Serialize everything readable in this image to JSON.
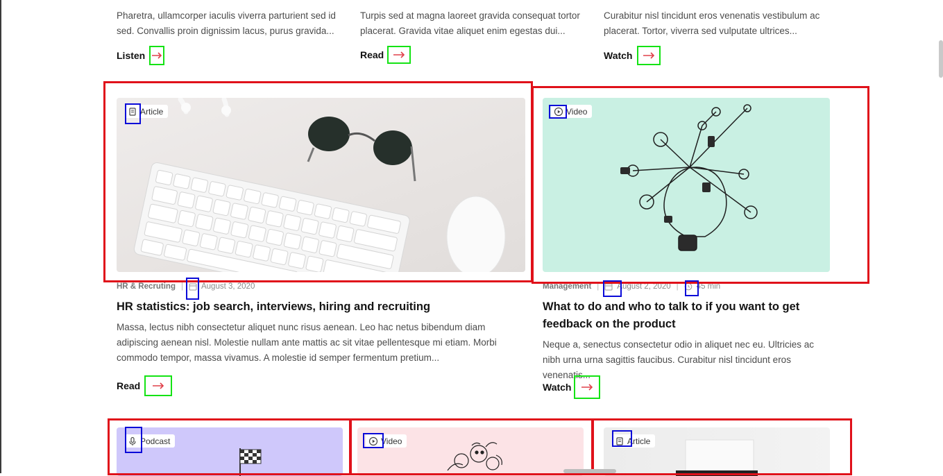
{
  "top_row": [
    {
      "excerpt": "Pharetra, ullamcorper iaculis viverra parturient sed id sed. Convallis proin dignissim lacus, purus gravida...",
      "cta": "Listen"
    },
    {
      "excerpt": "Turpis sed at magna laoreet gravida consequat tortor placerat. Gravida vitae aliquet enim egestas dui...",
      "cta": "Read"
    },
    {
      "excerpt": "Curabitur nisl tincidunt eros venenatis vestibulum ac placerat. Tortor, viverra sed vulputate ultrices...",
      "cta": "Watch"
    }
  ],
  "featured": [
    {
      "badge": "Article",
      "badge_icon": "document-icon",
      "category": "HR & Recruting",
      "date": "August 3, 2020",
      "title": "HR statistics: job search,  interviews, hiring and recruiting",
      "excerpt": "Massa, lectus nibh consectetur aliquet nunc risus aenean. Leo hac netus bibendum diam adipiscing aenean nisl. Molestie nullam ante mattis ac sit vitae pellentesque mi etiam. Morbi commodo tempor, massa vivamus. A molestie id semper fermentum pretium...",
      "cta": "Read"
    },
    {
      "badge": "Video",
      "badge_icon": "play-icon",
      "category": "Management",
      "date": "August 2, 2020",
      "duration": "45 min",
      "title": "What to do and who to talk to if you want to get feedback on the product",
      "excerpt": "Neque a, senectus consectetur odio in aliquet nec eu. Ultricies ac nibh urna urna sagittis faucibus. Curabitur nisl tincidunt eros venenatis...",
      "cta": "Watch"
    }
  ],
  "bottom_row": [
    {
      "badge": "Podcast",
      "badge_icon": "microphone-icon"
    },
    {
      "badge": "Video",
      "badge_icon": "play-icon"
    },
    {
      "badge": "Article",
      "badge_icon": "document-icon"
    }
  ],
  "colors": {
    "accent_arrow": "#e0404a",
    "annotation_green": "#14e314",
    "annotation_red": "#e0111a",
    "annotation_blue": "#0a0ad8"
  }
}
